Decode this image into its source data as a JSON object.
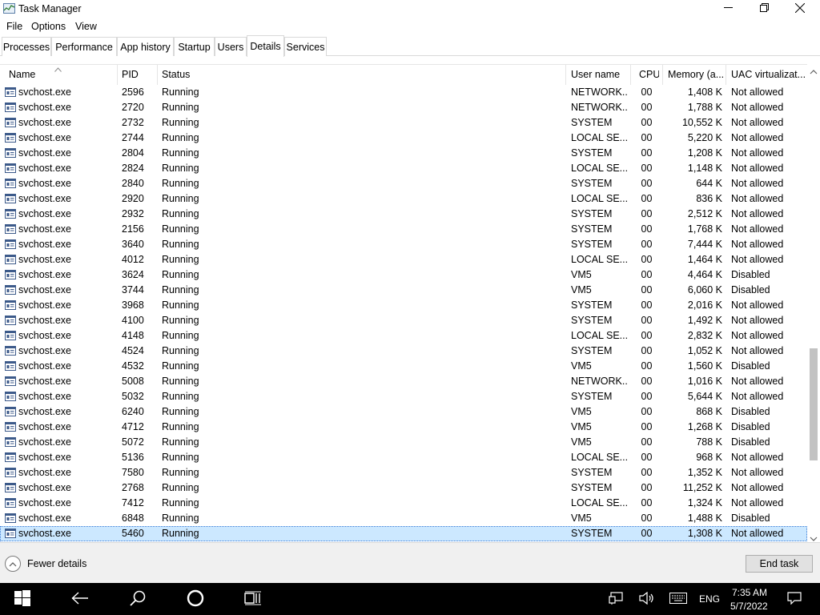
{
  "window": {
    "title": "Task Manager",
    "controls": [
      "minimize",
      "maximize",
      "close"
    ]
  },
  "menu": [
    "File",
    "Options",
    "View"
  ],
  "tabs": [
    {
      "label": "Processes"
    },
    {
      "label": "Performance"
    },
    {
      "label": "App history"
    },
    {
      "label": "Startup"
    },
    {
      "label": "Users"
    },
    {
      "label": "Details",
      "active": true
    },
    {
      "label": "Services"
    }
  ],
  "table": {
    "columns": [
      "Name",
      "PID",
      "Status",
      "User name",
      "CPU",
      "Memory (a...",
      "UAC virtualizat..."
    ],
    "rows": [
      [
        "svchost.exe",
        "2596",
        "Running",
        "NETWORK...",
        "00",
        "1,408 K",
        "Not allowed"
      ],
      [
        "svchost.exe",
        "2720",
        "Running",
        "NETWORK...",
        "00",
        "1,788 K",
        "Not allowed"
      ],
      [
        "svchost.exe",
        "2732",
        "Running",
        "SYSTEM",
        "00",
        "10,552 K",
        "Not allowed"
      ],
      [
        "svchost.exe",
        "2744",
        "Running",
        "LOCAL SE...",
        "00",
        "5,220 K",
        "Not allowed"
      ],
      [
        "svchost.exe",
        "2804",
        "Running",
        "SYSTEM",
        "00",
        "1,208 K",
        "Not allowed"
      ],
      [
        "svchost.exe",
        "2824",
        "Running",
        "LOCAL SE...",
        "00",
        "1,148 K",
        "Not allowed"
      ],
      [
        "svchost.exe",
        "2840",
        "Running",
        "SYSTEM",
        "00",
        "644 K",
        "Not allowed"
      ],
      [
        "svchost.exe",
        "2920",
        "Running",
        "LOCAL SE...",
        "00",
        "836 K",
        "Not allowed"
      ],
      [
        "svchost.exe",
        "2932",
        "Running",
        "SYSTEM",
        "00",
        "2,512 K",
        "Not allowed"
      ],
      [
        "svchost.exe",
        "2156",
        "Running",
        "SYSTEM",
        "00",
        "1,768 K",
        "Not allowed"
      ],
      [
        "svchost.exe",
        "3640",
        "Running",
        "SYSTEM",
        "00",
        "7,444 K",
        "Not allowed"
      ],
      [
        "svchost.exe",
        "4012",
        "Running",
        "LOCAL SE...",
        "00",
        "1,464 K",
        "Not allowed"
      ],
      [
        "svchost.exe",
        "3624",
        "Running",
        "VM5",
        "00",
        "4,464 K",
        "Disabled"
      ],
      [
        "svchost.exe",
        "3744",
        "Running",
        "VM5",
        "00",
        "6,060 K",
        "Disabled"
      ],
      [
        "svchost.exe",
        "3968",
        "Running",
        "SYSTEM",
        "00",
        "2,016 K",
        "Not allowed"
      ],
      [
        "svchost.exe",
        "4100",
        "Running",
        "SYSTEM",
        "00",
        "1,492 K",
        "Not allowed"
      ],
      [
        "svchost.exe",
        "4148",
        "Running",
        "LOCAL SE...",
        "00",
        "2,832 K",
        "Not allowed"
      ],
      [
        "svchost.exe",
        "4524",
        "Running",
        "SYSTEM",
        "00",
        "1,052 K",
        "Not allowed"
      ],
      [
        "svchost.exe",
        "4532",
        "Running",
        "VM5",
        "00",
        "1,560 K",
        "Disabled"
      ],
      [
        "svchost.exe",
        "5008",
        "Running",
        "NETWORK...",
        "00",
        "1,016 K",
        "Not allowed"
      ],
      [
        "svchost.exe",
        "5032",
        "Running",
        "SYSTEM",
        "00",
        "5,644 K",
        "Not allowed"
      ],
      [
        "svchost.exe",
        "6240",
        "Running",
        "VM5",
        "00",
        "868 K",
        "Disabled"
      ],
      [
        "svchost.exe",
        "4712",
        "Running",
        "VM5",
        "00",
        "1,268 K",
        "Disabled"
      ],
      [
        "svchost.exe",
        "5072",
        "Running",
        "VM5",
        "00",
        "788 K",
        "Disabled"
      ],
      [
        "svchost.exe",
        "5136",
        "Running",
        "LOCAL SE...",
        "00",
        "968 K",
        "Not allowed"
      ],
      [
        "svchost.exe",
        "7580",
        "Running",
        "SYSTEM",
        "00",
        "1,352 K",
        "Not allowed"
      ],
      [
        "svchost.exe",
        "2768",
        "Running",
        "SYSTEM",
        "00",
        "11,252 K",
        "Not allowed"
      ],
      [
        "svchost.exe",
        "7412",
        "Running",
        "LOCAL SE...",
        "00",
        "1,324 K",
        "Not allowed"
      ],
      [
        "svchost.exe",
        "6848",
        "Running",
        "VM5",
        "00",
        "1,488 K",
        "Disabled"
      ],
      [
        "svchost.exe",
        "5460",
        "Running",
        "SYSTEM",
        "00",
        "1,308 K",
        "Not allowed"
      ]
    ],
    "selected_row": 29,
    "sort_column": "Name",
    "sort_direction": "ascending"
  },
  "footer": {
    "fewer_details": "Fewer details",
    "end_task": "End task"
  },
  "taskbar": {
    "language": "ENG",
    "time": "7:35 AM",
    "date": "5/7/2022",
    "icons": [
      "windows-start-icon",
      "back-icon",
      "search-icon",
      "cortana-icon",
      "task-view-icon",
      "network-icon",
      "volume-icon",
      "keyboard-icon",
      "notifications-icon"
    ]
  },
  "colors": {
    "selected_row": "#cce8ff",
    "taskbar": "#000000",
    "footer": "#f0f0f0"
  }
}
